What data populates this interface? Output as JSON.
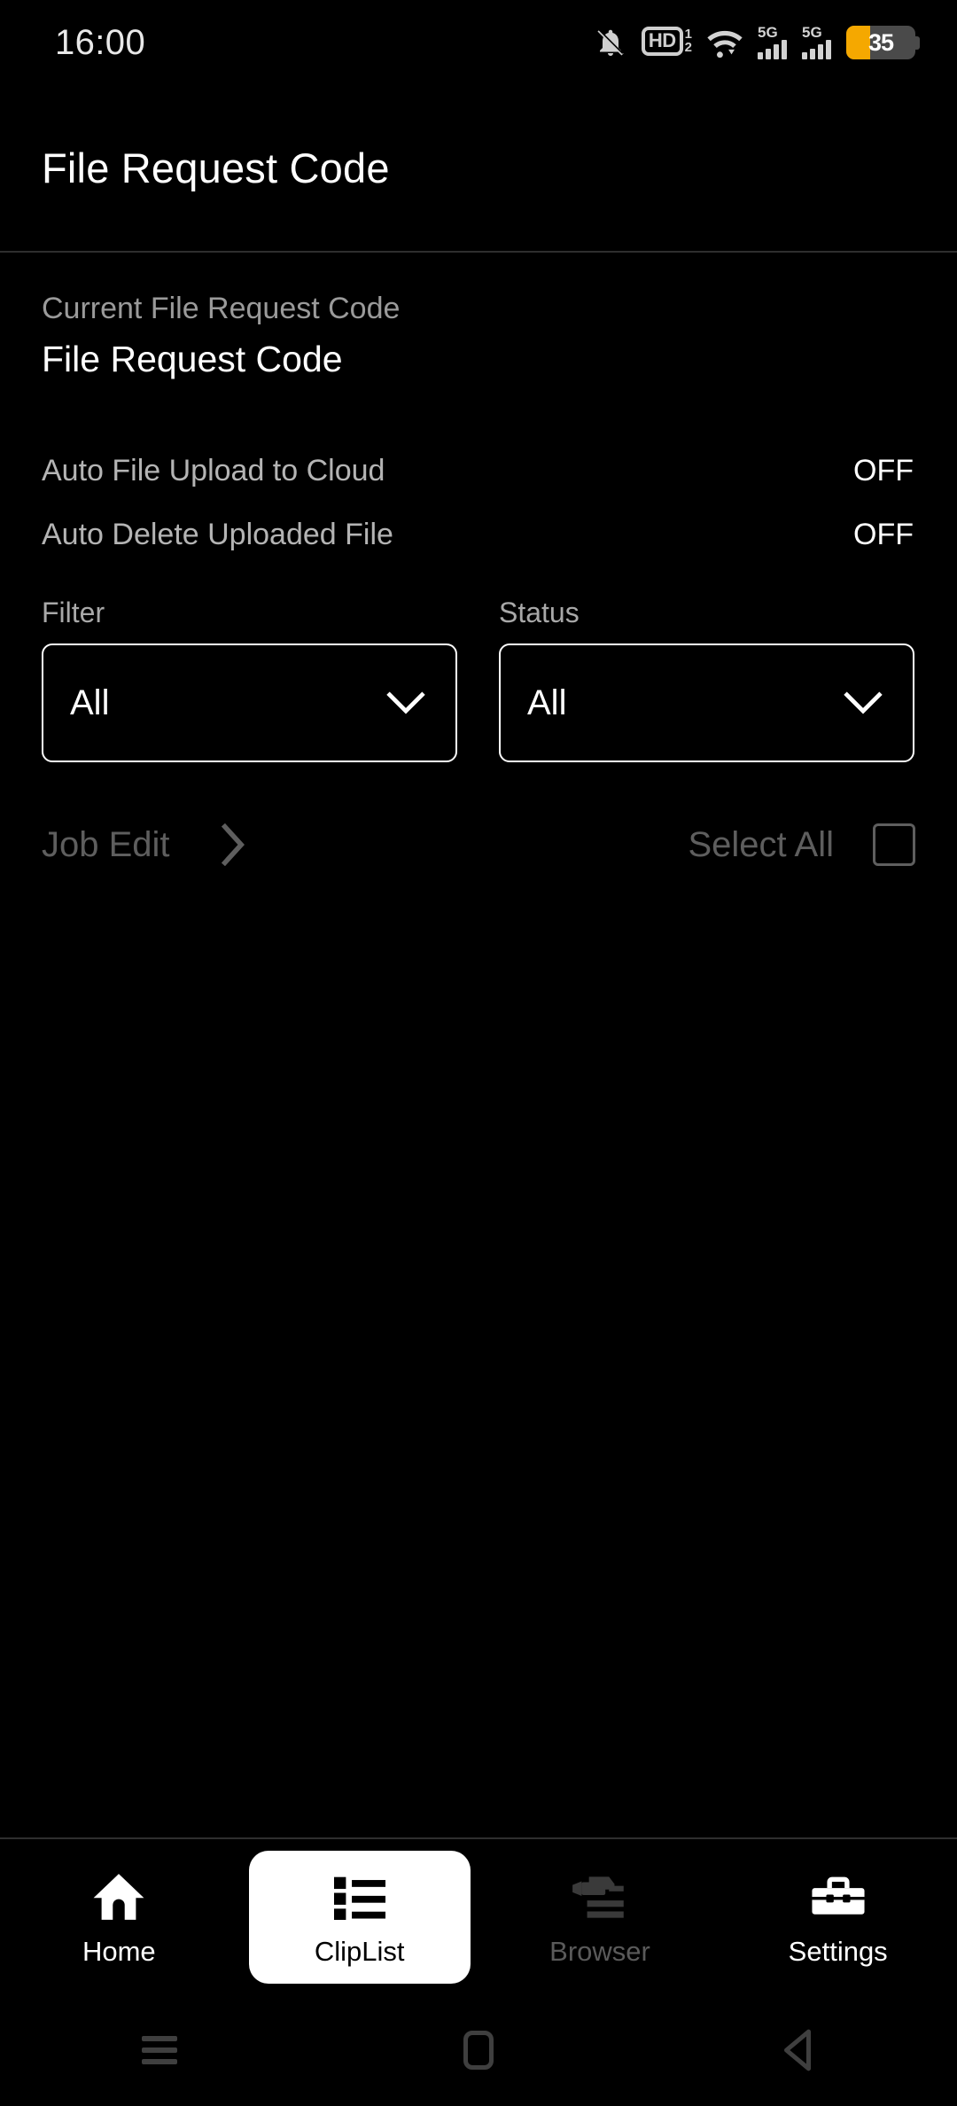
{
  "status_bar": {
    "time": "16:00",
    "icons": [
      "mute-bell-icon",
      "hd-icon",
      "wifi-icon",
      "signal-5g-icon",
      "signal-5g-icon",
      "battery-icon"
    ],
    "hd_label": "HD",
    "hd_sim_1": "1",
    "hd_sim_2": "2",
    "network_1": "5G",
    "network_2": "5G",
    "battery_level": "35",
    "battery_percent": 35,
    "battery_fill_color": "#f5a800",
    "battery_bg_color": "#4a4a4a"
  },
  "header": {
    "title": "File Request Code"
  },
  "content": {
    "code_section": {
      "label": "Current File Request Code",
      "value": "File Request Code"
    },
    "options": [
      {
        "label": "Auto File Upload to Cloud",
        "value": "OFF"
      },
      {
        "label": "Auto Delete Uploaded File",
        "value": "OFF"
      }
    ],
    "filters": [
      {
        "label": "Filter",
        "value": "All",
        "options": [
          "All"
        ]
      },
      {
        "label": "Status",
        "value": "All",
        "options": [
          "All"
        ]
      }
    ],
    "job_row": {
      "job_edit_label": "Job Edit",
      "select_all_label": "Select All",
      "checkbox_checked": false,
      "disabled": true
    }
  },
  "bottom_nav": {
    "items": [
      {
        "label": "Home",
        "icon": "home-icon",
        "state": "normal"
      },
      {
        "label": "ClipList",
        "icon": "list-icon",
        "state": "active"
      },
      {
        "label": "Browser",
        "icon": "dashcam-browser-icon",
        "state": "dimmed"
      },
      {
        "label": "Settings",
        "icon": "toolbox-icon",
        "state": "normal"
      }
    ]
  },
  "android_nav": {
    "items": [
      "recents-icon",
      "home-square-icon",
      "back-triangle-icon"
    ]
  },
  "colors": {
    "background": "#000000",
    "text_primary": "#ffffff",
    "text_secondary": "#9a9a9a",
    "text_disabled": "#5e5e5e",
    "divider": "#2e2e2e"
  }
}
